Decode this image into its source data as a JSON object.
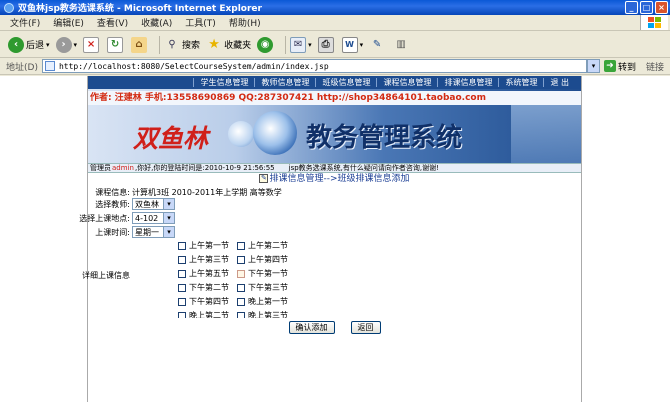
{
  "window": {
    "title": "双鱼林jsp教务选课系统 - Microsoft Internet Explorer",
    "minimize": "_",
    "maximize": "□",
    "close": "×"
  },
  "menu": [
    "文件(F)",
    "编辑(E)",
    "查看(V)",
    "收藏(A)",
    "工具(T)",
    "帮助(H)"
  ],
  "toolbar": {
    "back": "后退",
    "search": "搜索",
    "favorites": "收藏夹"
  },
  "address": {
    "label": "地址(D)",
    "url": "http://localhost:8080/SelectCourseSystem/admin/index.jsp",
    "go": "转到",
    "links": "链接"
  },
  "nav": [
    "学生信息管理",
    "教师信息管理",
    "班级信息管理",
    "课程信息管理",
    "排课信息管理",
    "系统管理",
    "退 出"
  ],
  "banner": {
    "author_line": "作者: 汪建林  手机:13558690869 QQ:287307421 http://shop34864101.taobao.com",
    "brand_left": "双鱼林",
    "brand_right": "教务管理系统"
  },
  "status": {
    "prefix": "管理员",
    "username": "admin",
    "suffix": ",你好,你的登陆时间是:2010-10-9 21:56:55",
    "marquee": "jsp教务选课系统,有什么疑问请向作者咨询,谢谢!"
  },
  "breadcrumb": "排课信息管理-->班级排课信息添加",
  "form": {
    "course_info_label": "课程信息:",
    "course_info_value": "计算机3班 2010-2011年上学期 高等数学",
    "teacher_label": "选择教师:",
    "teacher_value": "双鱼林",
    "place_label": "选择上课地点:",
    "place_value": "4-102",
    "time_label": "上课时间:",
    "time_value": "星期一",
    "detail_label": "详细上课信息"
  },
  "periods": [
    [
      "上午第一节",
      "上午第二节"
    ],
    [
      "上午第三节",
      "上午第四节"
    ],
    [
      "上午第五节",
      "下午第一节"
    ],
    [
      "下午第二节",
      "下午第三节"
    ],
    [
      "下午第四节",
      "晚上第一节"
    ],
    [
      "晚上第二节",
      "晚上第三节"
    ]
  ],
  "buttons": {
    "confirm": "确认添加",
    "back": "返回"
  }
}
